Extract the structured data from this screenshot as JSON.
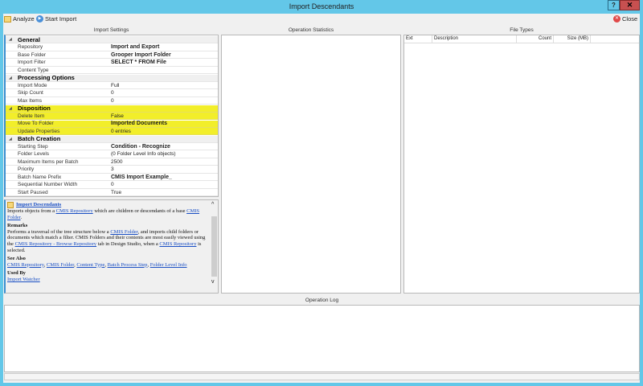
{
  "window": {
    "title": "Import Descendants",
    "help": "?",
    "close": "✕"
  },
  "toolbar": {
    "analyze": "Analyze",
    "start_import": "Start Import",
    "close": "Close"
  },
  "sections": {
    "import_settings": "Import Settings",
    "operation_statistics": "Operation Statistics",
    "file_types": "File Types",
    "operation_log": "Operation Log"
  },
  "property_grid": [
    {
      "type": "cat",
      "name": "General"
    },
    {
      "name": "Repository",
      "value": "Import and Export",
      "bold": true
    },
    {
      "name": "Base Folder",
      "value": "Grooper Import Folder",
      "bold": true
    },
    {
      "name": "Import Filter",
      "value": "SELECT * FROM File",
      "bold": true
    },
    {
      "name": "Content Type",
      "value": ""
    },
    {
      "type": "cat",
      "name": "Processing Options"
    },
    {
      "name": "Import Mode",
      "value": "Full"
    },
    {
      "name": "Skip Count",
      "value": "0"
    },
    {
      "name": "Max Items",
      "value": "0"
    },
    {
      "type": "cat",
      "name": "Disposition",
      "hl": true
    },
    {
      "name": "Delete Item",
      "value": "False",
      "hl": true
    },
    {
      "name": "Move To Folder",
      "value": "Imported Documents",
      "bold": true,
      "hl": true
    },
    {
      "name": "Update Properties",
      "value": "0 entries",
      "hl": true
    },
    {
      "type": "cat",
      "name": "Batch Creation"
    },
    {
      "name": "Starting Step",
      "value": "Condition - Recognize",
      "bold": true
    },
    {
      "name": "Folder Levels",
      "value": "(0 Folder Level Info objects)"
    },
    {
      "name": "Maximum Items per Batch",
      "value": "2500"
    },
    {
      "name": "Priority",
      "value": "3"
    },
    {
      "name": "Batch Name Prefix",
      "value": "CMIS Import Example_",
      "bold": true
    },
    {
      "name": "Sequential Number Width",
      "value": "0"
    },
    {
      "name": "Start Paused",
      "value": "True"
    }
  ],
  "help": {
    "title": "Import Descendants",
    "intro_1": "Imports objects from a ",
    "intro_link1": "CMIS Repository",
    "intro_2": " which are children or descendants of a base ",
    "intro_link2": "CMIS Folder",
    "intro_3": ".",
    "remarks_h": "Remarks",
    "rem_1": "Performs a traversal of the tree structure below a ",
    "rem_link1": "CMIS Folder",
    "rem_2": ", and imports child folders or documents which match a filter. CMIS Folders and their contents are most easily viewed using the ",
    "rem_link2": "CMIS Repository - Browse Repository",
    "rem_3": " tab in Design Studio, when a ",
    "rem_link3": "CMIS Repository",
    "rem_4": " is selected.",
    "see_also_h": "See Also",
    "see_also": [
      "CMIS Repository",
      "CMIS Folder",
      "Content Type",
      "Batch Process Step",
      "Folder Level Info"
    ],
    "used_by_h": "Used By",
    "used_by": "Import Watcher"
  },
  "file_types": {
    "columns": [
      "Ext",
      "Description",
      "Count",
      "Size (MB)"
    ]
  }
}
